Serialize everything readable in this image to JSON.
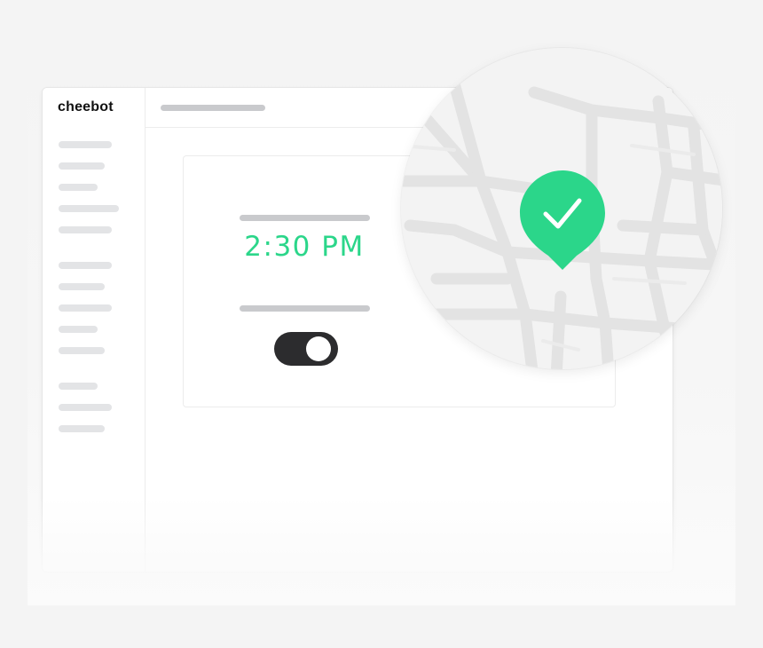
{
  "app": {
    "logo_text": "cheebot"
  },
  "schedule_card": {
    "time": "2:30 PM",
    "toggle": {
      "state": "on"
    }
  },
  "map_lens": {
    "pin": {
      "status": "confirmed",
      "icon": "checkmark-icon",
      "color": "#2bd68a"
    }
  },
  "colors": {
    "accent": "#2bd68a",
    "toggle_track": "#2c2c2e"
  }
}
